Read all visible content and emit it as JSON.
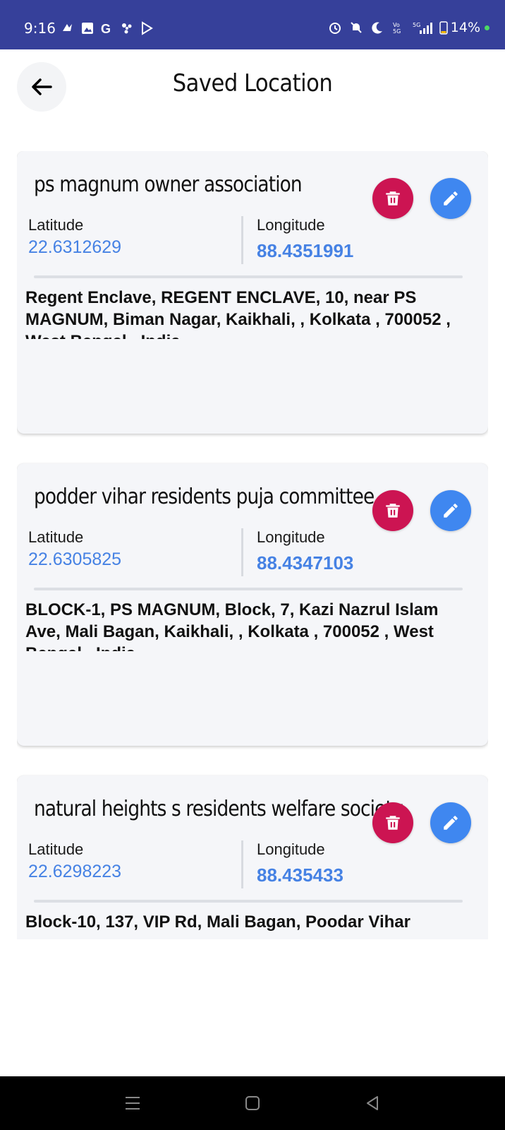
{
  "status_bar": {
    "time": "9:16",
    "battery": "14%",
    "icons_left": [
      "app-icon",
      "gallery-icon",
      "google-icon",
      "fan-icon",
      "play-store-icon"
    ],
    "icons_right": [
      "alarm-icon",
      "mute-icon",
      "moon-icon",
      "volte-icon",
      "5g-signal-icon",
      "battery-icon"
    ]
  },
  "header": {
    "title": "Saved Location"
  },
  "labels": {
    "latitude": "Latitude",
    "longitude": "Longitude"
  },
  "colors": {
    "status_bar": "#36409a",
    "delete": "#cc1452",
    "edit": "#3f87f0",
    "value_text": "#4682e4",
    "card_bg": "#f5f6f9"
  },
  "locations": [
    {
      "name": "ps magnum owner association",
      "latitude": "22.6312629",
      "longitude": "88.4351991",
      "address": "Regent Enclave, REGENT ENCLAVE, 10, near PS MAGNUM, Biman Nagar, Kaikhali,  , Kolkata , 700052 , West Bengal , India"
    },
    {
      "name": "podder vihar residents puja committee",
      "latitude": "22.6305825",
      "longitude": "88.4347103",
      "address": "BLOCK-1, PS MAGNUM, Block, 7, Kazi Nazrul Islam Ave, Mali Bagan, Kaikhali,  , Kolkata , 700052 , West Bengal , India"
    },
    {
      "name": "natural heights s residents welfare society",
      "latitude": "22.6298223",
      "longitude": "88.435433",
      "address": "Block-10, 137, VIP Rd, Mali Bagan, Poodar Vihar"
    }
  ]
}
